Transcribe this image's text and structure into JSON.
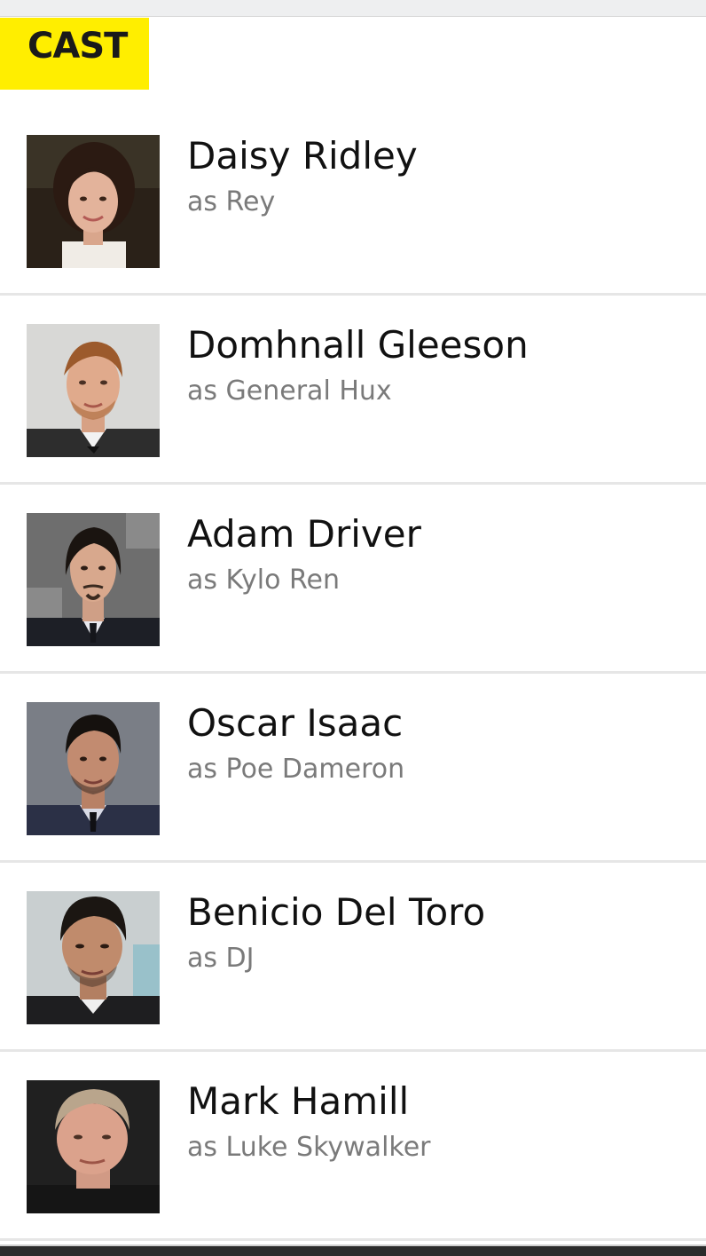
{
  "section": {
    "title": "CAST"
  },
  "cast": [
    {
      "name": "Daisy Ridley",
      "role": "as Rey",
      "photo_icon": "actor-photo"
    },
    {
      "name": "Domhnall Gleeson",
      "role": "as General Hux",
      "photo_icon": "actor-photo"
    },
    {
      "name": "Adam Driver",
      "role": "as Kylo Ren",
      "photo_icon": "actor-photo"
    },
    {
      "name": "Oscar Isaac",
      "role": "as Poe Dameron",
      "photo_icon": "actor-photo"
    },
    {
      "name": "Benicio Del Toro",
      "role": "as DJ",
      "photo_icon": "actor-photo"
    },
    {
      "name": "Mark Hamill",
      "role": "as Luke Skywalker",
      "photo_icon": "actor-photo"
    }
  ],
  "colors": {
    "header_accent": "#ffee00",
    "name_text": "#111111",
    "role_text": "#7a7a7a",
    "divider": "#e6e6e6"
  }
}
